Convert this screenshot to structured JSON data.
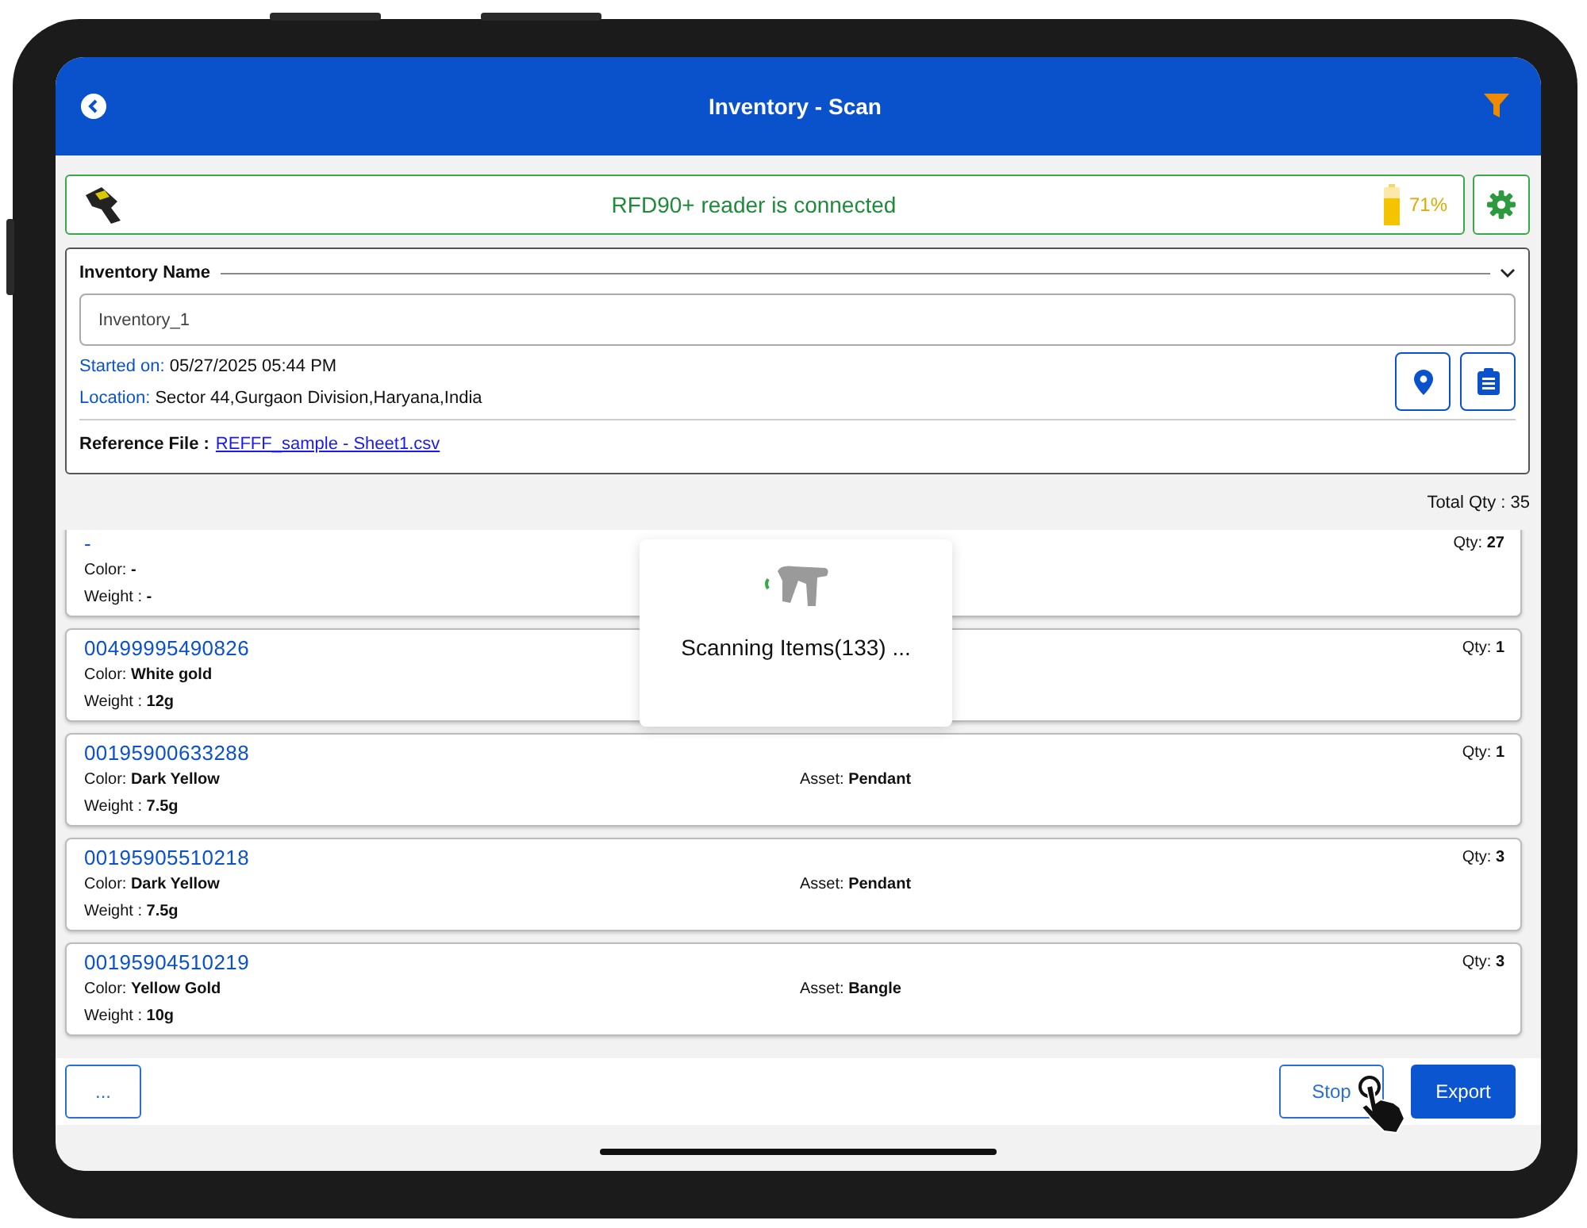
{
  "header": {
    "title": "Inventory - Scan"
  },
  "reader": {
    "status": "RFD90+ reader is connected",
    "battery": {
      "level": 0.71,
      "reading": "71%"
    }
  },
  "inventory": {
    "label": "Inventory Name",
    "expanded": true,
    "name_value": "Inventory_1",
    "started_label": "Started on:",
    "started_value": "05/27/2025 05:44 PM",
    "location_label": "Location:",
    "location_value": "Sector 44,Gurgaon Division,Haryana,India",
    "reference_label": "Reference File :",
    "reference_link": "REFFF_sample - Sheet1.csv"
  },
  "total_qty": "Total Qty : 35",
  "items": [
    {
      "id": "-",
      "color_label": "Color:",
      "metal_color": "-",
      "weight_label": "Weight :",
      "weight": "-",
      "qty_label": "Qty:",
      "qty": "27"
    },
    {
      "id": "00499995490826",
      "color_label": "Color:",
      "metal_color": "White gold",
      "weight_label": "Weight :",
      "weight": "12g",
      "qty_label": "Qty:",
      "qty": "1"
    },
    {
      "id": "00195900633288",
      "color_label": "Color:",
      "metal_color": "Dark Yellow",
      "weight_label": "Weight :",
      "weight": "7.5g",
      "asset_label": "Asset:",
      "asset": "Pendant",
      "qty_label": "Qty:",
      "qty": "1"
    },
    {
      "id": "00195905510218",
      "color_label": "Color:",
      "metal_color": "Dark Yellow",
      "weight_label": "Weight :",
      "weight": "7.5g",
      "asset_label": "Asset:",
      "asset": "Pendant",
      "qty_label": "Qty:",
      "qty": "3"
    },
    {
      "id": "00195904510219",
      "color_label": "Color:",
      "metal_color": "Yellow Gold",
      "weight_label": "Weight :",
      "weight": "10g",
      "asset_label": "Asset:",
      "asset": "Bangle",
      "qty_label": "Qty:",
      "qty": "3"
    }
  ],
  "scan_popup": {
    "message": "Scanning Items(133) ..."
  },
  "footer": {
    "more_button": "...",
    "stop_button": "Stop",
    "export_button": "Export"
  }
}
